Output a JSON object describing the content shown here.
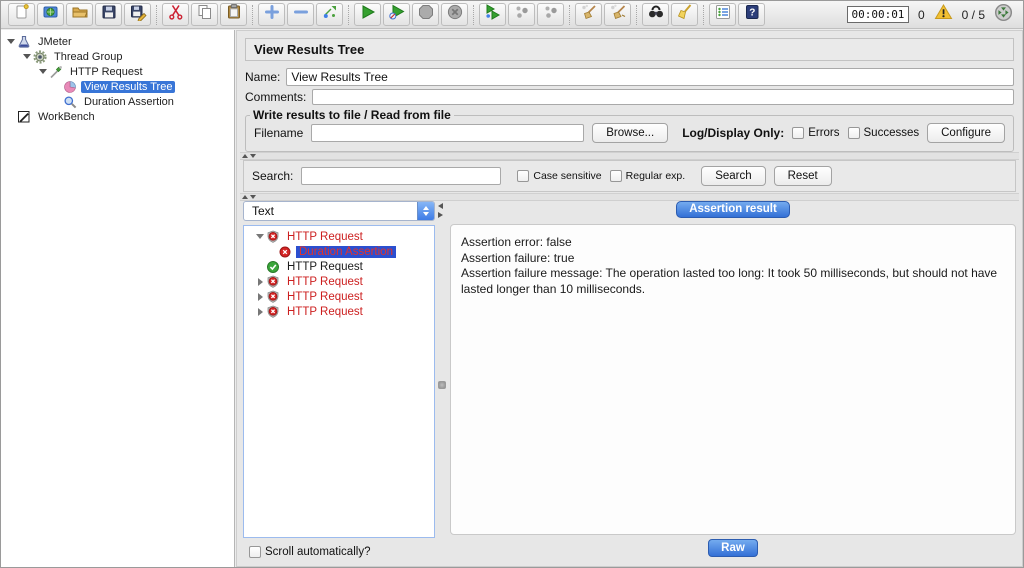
{
  "toolbar": {
    "icons": [
      "new-file",
      "open-templates",
      "open-file",
      "save",
      "save-as",
      "cut",
      "copy",
      "paste",
      "add",
      "remove",
      "toggle",
      "start",
      "start-no-timers",
      "stop",
      "shutdown",
      "remote-start",
      "remote-start-all",
      "remote-stop",
      "clear",
      "clear-all",
      "search",
      "search-reset",
      "function-helper",
      "help",
      "warning",
      "active-threads"
    ],
    "timer": "00:00:01",
    "error_count": "0",
    "thread_count": "0 / 5"
  },
  "sidebar": {
    "items": [
      {
        "label": "JMeter"
      },
      {
        "label": "Thread Group"
      },
      {
        "label": "HTTP Request"
      },
      {
        "label": "View Results Tree",
        "selected": true
      },
      {
        "label": "Duration Assertion"
      },
      {
        "label": "WorkBench"
      }
    ]
  },
  "main": {
    "title": "View Results Tree",
    "name_label": "Name:",
    "name_value": "View Results Tree",
    "comments_label": "Comments:",
    "file_section": {
      "legend": "Write results to file / Read from file",
      "filename_label": "Filename",
      "browse_button": "Browse...",
      "log_display_label": "Log/Display Only:",
      "errors_checkbox": "Errors",
      "successes_checkbox": "Successes",
      "configure_button": "Configure"
    },
    "search_section": {
      "label": "Search:",
      "case_sensitive": "Case sensitive",
      "regular_exp": "Regular exp.",
      "search_button": "Search",
      "reset_button": "Reset"
    },
    "results_panel": {
      "view_mode": "Text",
      "tree": [
        {
          "label": "HTTP Request",
          "status": "failed",
          "expander": "open"
        },
        {
          "label": "Duration Assertion",
          "status": "failed",
          "selected": true
        },
        {
          "label": "HTTP Request",
          "status": "success"
        },
        {
          "label": "HTTP Request",
          "status": "failed",
          "expander": "closed"
        },
        {
          "label": "HTTP Request",
          "status": "failed",
          "expander": "closed"
        },
        {
          "label": "HTTP Request",
          "status": "failed",
          "expander": "closed"
        }
      ],
      "scroll_checkbox": "Scroll automatically?"
    },
    "assertion_panel": {
      "tab": "Assertion result",
      "lines": [
        "Assertion error: false",
        "Assertion failure: true",
        "Assertion failure message: The operation lasted too long: It took 50 milliseconds, but should not have lasted longer than 10 milliseconds."
      ],
      "raw_button": "Raw"
    }
  },
  "colors": {
    "tree_selection": "#3875d7",
    "results_selection": "#2b4fd0",
    "failed_red": "#cc1f1f",
    "blue_button": "#3470d6",
    "warning_yellow": "#f2c032"
  }
}
